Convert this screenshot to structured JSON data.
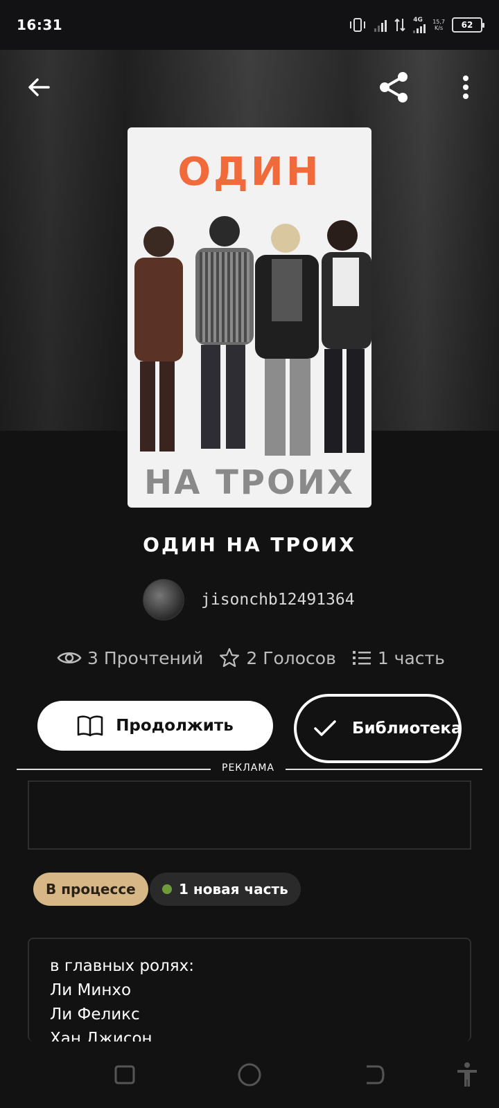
{
  "status_bar": {
    "time": "16:31",
    "network": "4G",
    "speed_value": "15,7",
    "speed_unit": "K/s",
    "battery": "62"
  },
  "header": {
    "back_icon": "arrow-left-icon",
    "share_icon": "share-icon",
    "menu_icon": "more-vertical-icon"
  },
  "cover": {
    "title": "ОДИН",
    "subtitle": "НА ТРОИХ"
  },
  "book": {
    "title": "ОДИН НА ТРОИХ",
    "author": "jisonchb12491364"
  },
  "stats": {
    "reads": "3 Прочтений",
    "votes": "2 Голосов",
    "parts": "1 часть"
  },
  "actions": {
    "continue_label": "Продолжить",
    "library_label": "Библиотека"
  },
  "ad": {
    "label": "РЕКЛАМА"
  },
  "badges": {
    "status": "В процессе",
    "new_parts": "1 новая часть"
  },
  "description": {
    "lines": [
      "в главных ролях:",
      "Ли Минхо",
      "Ли Феликс",
      "Хан Джисон"
    ]
  },
  "colors": {
    "background": "#121212",
    "accent_badge": "#d7b786",
    "new_dot": "#6f9b3a",
    "cover_title": "#f06a3b"
  }
}
